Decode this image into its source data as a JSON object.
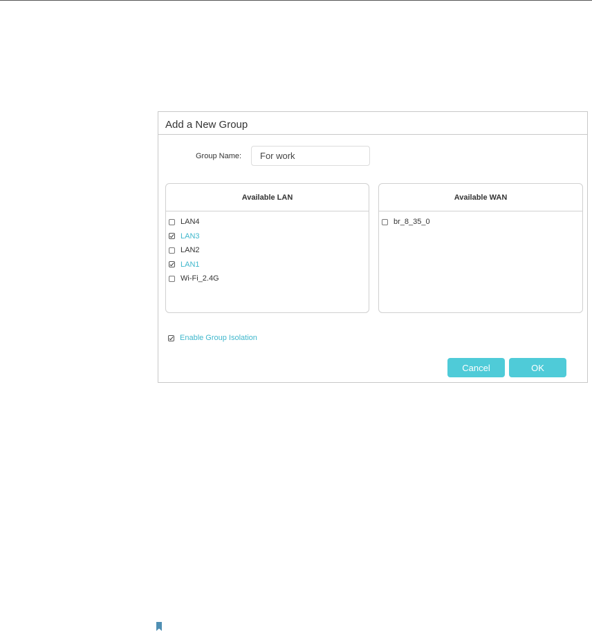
{
  "dialog": {
    "title": "Add a New Group",
    "group_name_label": "Group Name:",
    "group_name_value": "For work",
    "lan_panel": {
      "header": "Available LAN",
      "items": [
        {
          "label": "LAN4",
          "checked": false
        },
        {
          "label": "LAN3",
          "checked": true
        },
        {
          "label": "LAN2",
          "checked": false
        },
        {
          "label": "LAN1",
          "checked": true
        },
        {
          "label": "Wi-Fi_2.4G",
          "checked": false
        }
      ]
    },
    "wan_panel": {
      "header": "Available WAN",
      "items": [
        {
          "label": "br_8_35_0",
          "checked": false
        }
      ]
    },
    "isolation": {
      "label": "Enable Group Isolation",
      "checked": true
    },
    "cancel_label": "Cancel",
    "ok_label": "OK"
  },
  "colors": {
    "accent": "#4fcbd8",
    "checked_text": "#3fb7cc"
  }
}
